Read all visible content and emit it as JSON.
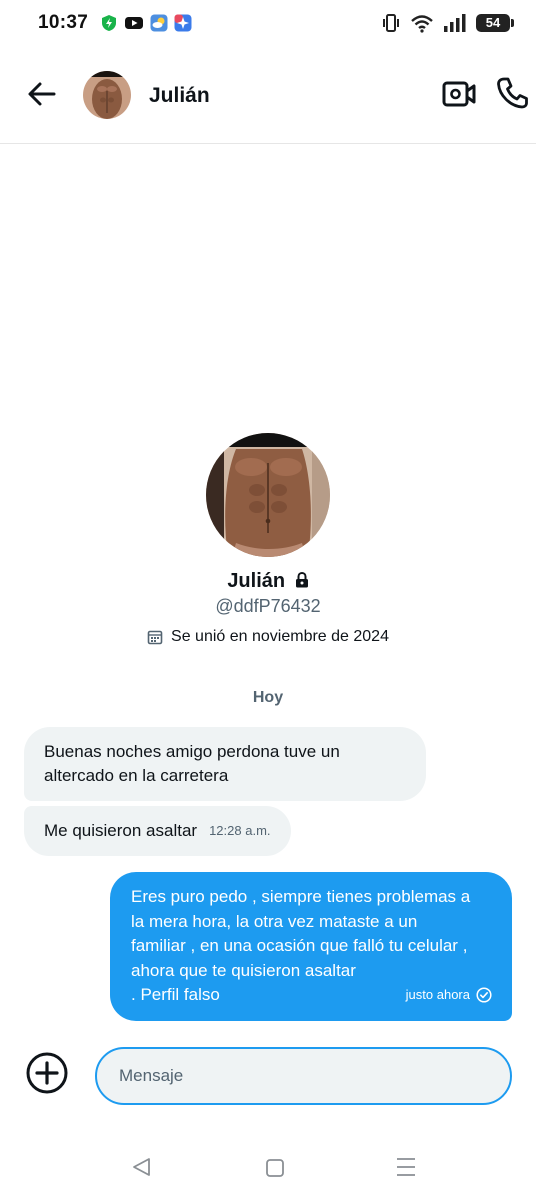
{
  "status_bar": {
    "time": "10:37",
    "battery": "54",
    "icons": [
      "shield-icon",
      "youtube-icon",
      "weather-icon",
      "app-icon",
      "vibrate-icon",
      "wifi-icon",
      "signal-icon",
      "battery-icon"
    ]
  },
  "header": {
    "contact_name": "Julián",
    "icons": [
      "back-arrow-icon",
      "video-call-icon",
      "phone-icon"
    ]
  },
  "profile": {
    "name": "Julián",
    "handle": "@ddfP76432",
    "joined": "Se unió en noviembre de 2024",
    "icons": [
      "lock-icon",
      "calendar-icon"
    ]
  },
  "conversation": {
    "date_separator": "Hoy",
    "incoming": [
      {
        "lines": [
          "Buenas noches amigo perdona tuve un",
          "altercado en la carretera"
        ]
      },
      {
        "text": "Me quisieron asaltar",
        "timestamp": "12:28 a.m."
      }
    ],
    "outgoing": [
      {
        "lines": [
          "Eres puro pedo , siempre tienes problemas a",
          "la mera hora, la otra vez mataste a un",
          "familiar , en una ocasión que falló tu celular ,",
          "ahora que te quisieron asaltar",
          ". Perfil falso"
        ],
        "timestamp": "justo ahora",
        "status_icon": "sent-check-icon"
      }
    ]
  },
  "composer": {
    "placeholder": "Mensaje",
    "icons": [
      "add-icon"
    ]
  },
  "nav_bar": {
    "icons": [
      "nav-back-icon",
      "nav-home-icon",
      "nav-menu-icon"
    ]
  },
  "colors": {
    "accent": "#1d9bf0",
    "bubble_incoming": "#eff3f4",
    "text_primary": "#0f1419",
    "text_secondary": "#536471"
  }
}
